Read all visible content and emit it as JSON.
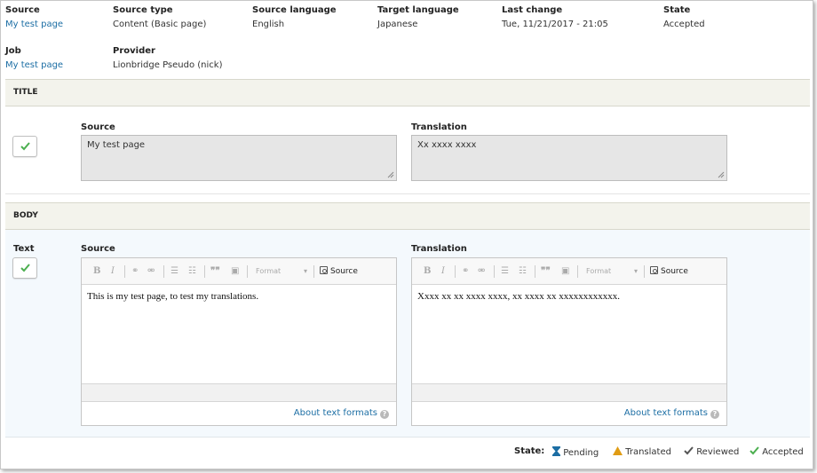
{
  "meta": {
    "source": {
      "label": "Source",
      "value": "My test page"
    },
    "source_type": {
      "label": "Source type",
      "value": "Content (Basic page)"
    },
    "source_language": {
      "label": "Source language",
      "value": "English"
    },
    "target_language": {
      "label": "Target language",
      "value": "Japanese"
    },
    "last_change": {
      "label": "Last change",
      "value": "Tue, 11/21/2017 - 21:05"
    },
    "state": {
      "label": "State",
      "value": "Accepted"
    },
    "job": {
      "label": "Job",
      "value": "My test page"
    },
    "provider": {
      "label": "Provider",
      "value": "Lionbridge Pseudo (nick)"
    }
  },
  "title_section": {
    "heading": "TITLE",
    "source_label": "Source",
    "source_value": "My test page",
    "translation_label": "Translation",
    "translation_value": "Xx xxxx xxxx"
  },
  "body_section": {
    "heading": "BODY",
    "field_label": "Text",
    "source_label": "Source",
    "translation_label": "Translation",
    "source_text": "This is my test page, to test my translations.",
    "translation_text": "Xxxx xx xx xxxx xxxx, xx xxxx xx xxxxxxxxxxxx.",
    "toolbar": {
      "bold": "B",
      "italic": "I",
      "format": "Format",
      "source_button": "Source"
    },
    "about_formats": "About text formats"
  },
  "legend": {
    "label": "State:",
    "items": [
      {
        "name": "Pending",
        "icon": "hourglass-icon",
        "color": "#1c6ea4"
      },
      {
        "name": "Translated",
        "icon": "warning-triangle-icon",
        "color": "#e09c14"
      },
      {
        "name": "Reviewed",
        "icon": "check-icon",
        "color": "#555555"
      },
      {
        "name": "Accepted",
        "icon": "check-icon",
        "color": "#4caf50"
      }
    ]
  },
  "colors": {
    "link": "#1c6ea4",
    "accepted_check": "#4caf50",
    "section_header_bg": "#f3f3ec",
    "body_row_bg": "#f4f9fd"
  }
}
